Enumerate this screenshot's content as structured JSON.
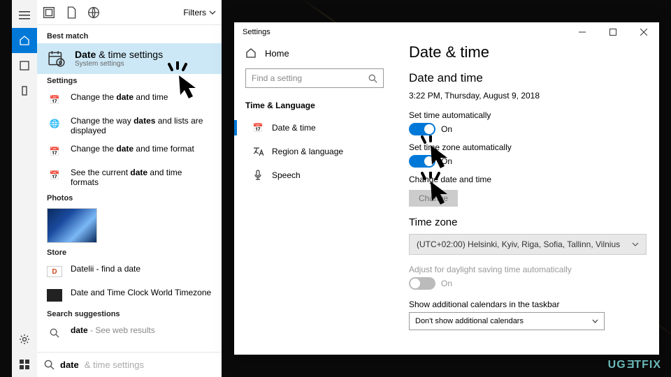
{
  "search": {
    "filters_label": "Filters",
    "best_match_label": "Best match",
    "best_result": {
      "title_html": "Date",
      "title_rest": " & time settings",
      "subtitle": "System settings"
    },
    "settings_label": "Settings",
    "settings_items": [
      "Change the date and time",
      "Change the way dates and lists are displayed",
      "Change the date and time format",
      "See the current date and time formats"
    ],
    "photos_label": "Photos",
    "store_label": "Store",
    "store_items": [
      "Datelii - find a date",
      "Date and Time Clock World Timezone"
    ],
    "suggestions_label": "Search suggestions",
    "suggestion": {
      "prefix": "date",
      "suffix": " - See web results"
    },
    "input_value": "date ",
    "input_placeholder": "& time settings"
  },
  "settings": {
    "window_title": "Settings",
    "home_label": "Home",
    "find_placeholder": "Find a setting",
    "nav_category": "Time & Language",
    "nav_items": [
      {
        "label": "Date & time",
        "active": true
      },
      {
        "label": "Region & language",
        "active": false
      },
      {
        "label": "Speech",
        "active": false
      }
    ],
    "page_title": "Date & time",
    "subheading": "Date and time",
    "current_datetime": "3:22 PM, Thursday, August 9, 2018",
    "auto_time_label": "Set time automatically",
    "auto_time_state": "On",
    "auto_tz_label": "Set time zone automatically",
    "auto_tz_state": "On",
    "change_dt_label": "Change date and time",
    "change_btn": "Change",
    "timezone_heading": "Time zone",
    "timezone_value": "(UTC+02:00) Helsinki, Kyiv, Riga, Sofia, Tallinn, Vilnius",
    "dst_label": "Adjust for daylight saving time automatically",
    "dst_state": "On",
    "calendars_label": "Show additional calendars in the taskbar",
    "calendars_value": "Don't show additional calendars"
  },
  "watermark": "UGETFIX"
}
